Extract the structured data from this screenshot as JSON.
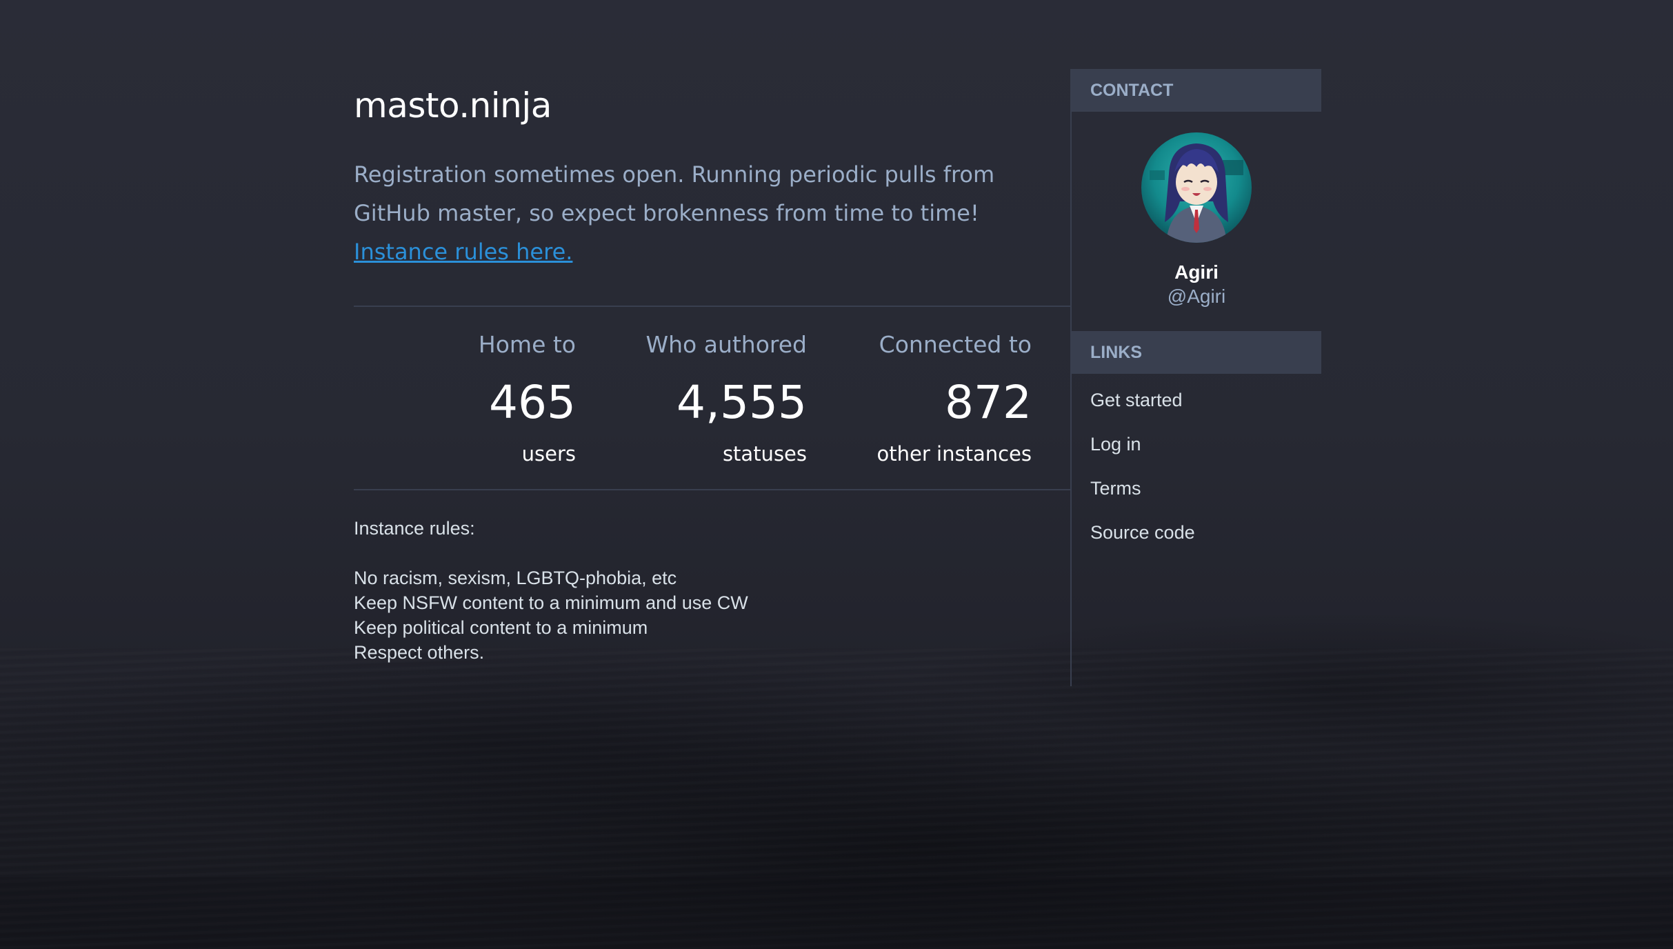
{
  "instance": {
    "title": "masto.ninja",
    "description": "Registration sometimes open. Running periodic pulls from GitHub master, so expect brokenness from time to time!",
    "rules_link": "Instance rules here."
  },
  "stats": {
    "users": {
      "label": "Home to",
      "value": "465",
      "unit": "users"
    },
    "statuses": {
      "label": "Who authored",
      "value": "4,555",
      "unit": "statuses"
    },
    "instances": {
      "label": "Connected to",
      "value": "872",
      "unit": "other instances"
    }
  },
  "rules": {
    "heading": "Instance rules:",
    "items": [
      "No racism, sexism, LGBTQ-phobia, etc",
      "Keep NSFW content to a minimum and use CW",
      "Keep political content to a minimum",
      "Respect others."
    ]
  },
  "sidebar": {
    "contact": {
      "header": "CONTACT",
      "name": "Agiri",
      "handle": "@Agiri"
    },
    "links": {
      "header": "LINKS",
      "items": [
        "Get started",
        "Log in",
        "Terms",
        "Source code"
      ]
    }
  },
  "colors": {
    "background": "#282a35",
    "panel_header": "#393f4f",
    "text_muted": "#9baec8",
    "link": "#2b90d9",
    "text_light": "#d9e1e8"
  }
}
